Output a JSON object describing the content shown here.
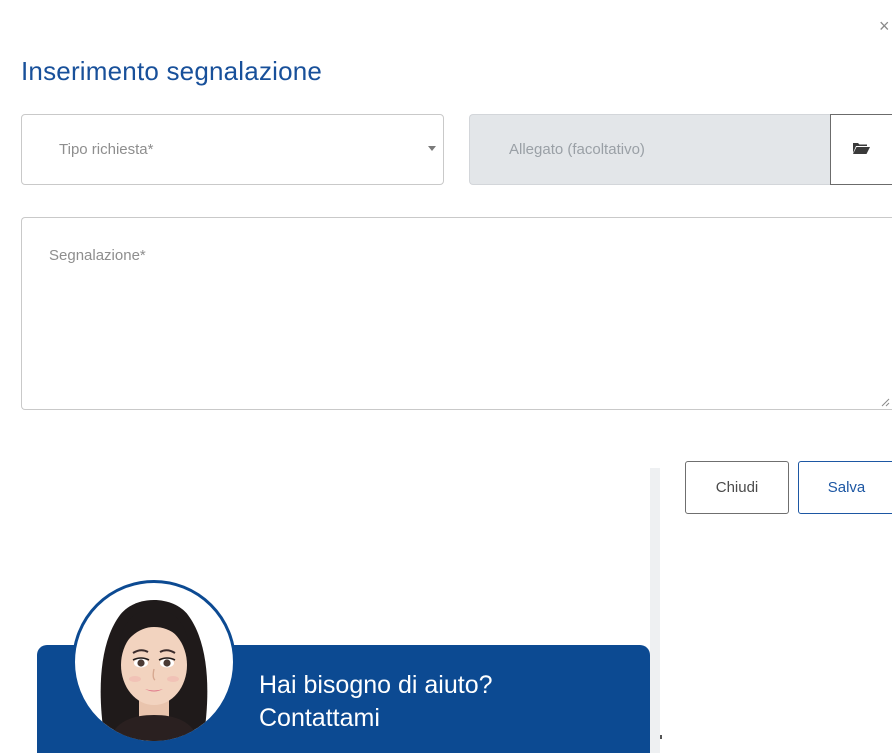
{
  "dialog": {
    "close_glyph": "×",
    "title": "Inserimento segnalazione"
  },
  "form": {
    "request_type": {
      "placeholder": "Tipo richiesta*",
      "icon": "caret-down-icon"
    },
    "attachment": {
      "placeholder": "Allegato (facoltativo)",
      "button_icon": "folder-open-icon"
    },
    "report": {
      "placeholder": "Segnalazione*"
    }
  },
  "actions": {
    "close_label": "Chiudi",
    "save_label": "Salva"
  },
  "help": {
    "line1": "Hai bisogno di aiuto?",
    "line2": "Contattami"
  },
  "colors": {
    "primary": "#18509a",
    "banner": "#0c4a92",
    "disabled_bg": "#e3e6e9"
  }
}
